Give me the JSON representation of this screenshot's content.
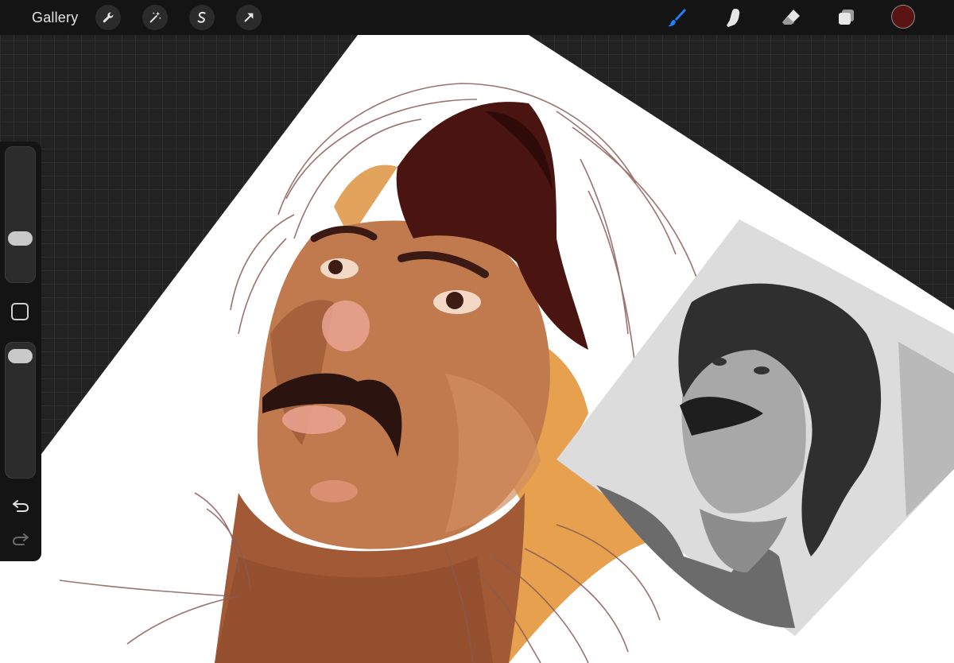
{
  "topbar": {
    "gallery_label": "Gallery",
    "left_tools": [
      {
        "name": "actions",
        "icon": "wrench-icon"
      },
      {
        "name": "adjustments",
        "icon": "magic-wand-icon"
      },
      {
        "name": "selection",
        "icon": "selection-s-icon"
      },
      {
        "name": "transform",
        "icon": "transform-arrow-icon"
      }
    ],
    "right_tools": [
      {
        "name": "brush",
        "icon": "brush-icon",
        "active": true
      },
      {
        "name": "smudge",
        "icon": "smudge-finger-icon",
        "active": false
      },
      {
        "name": "eraser",
        "icon": "eraser-icon",
        "active": false
      },
      {
        "name": "layers",
        "icon": "layers-icon",
        "active": false
      }
    ],
    "current_color": "#5a1414"
  },
  "sidebar": {
    "brush_size_level": 0.3,
    "opacity_level": 0.95
  },
  "colors": {
    "accent": "#1a84ff",
    "skin": "#c27a4e",
    "hair": "#4a1410",
    "background_fill": "#e6a04e",
    "sketch_line": "#8a5a55"
  }
}
